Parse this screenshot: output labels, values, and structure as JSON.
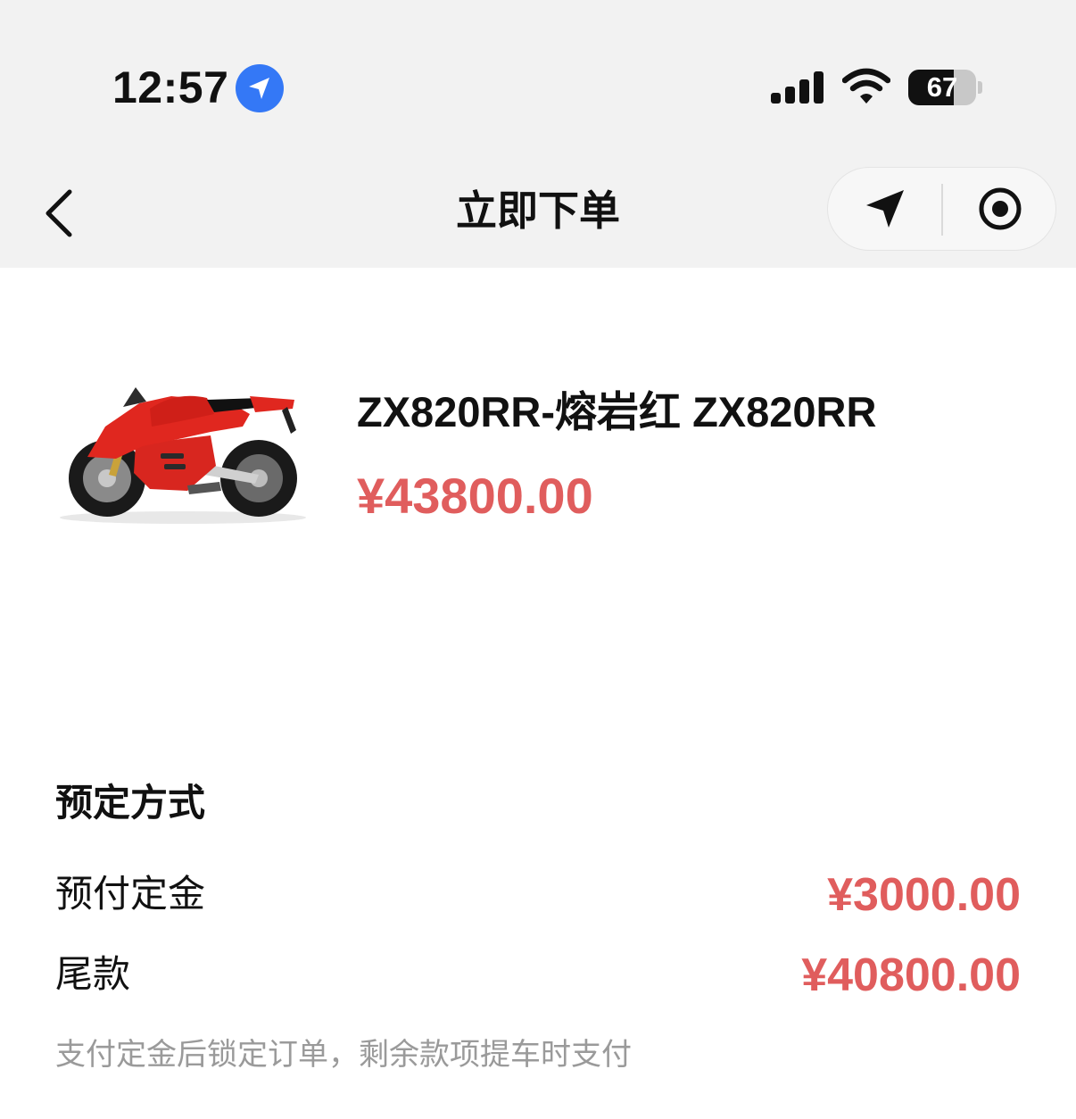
{
  "status_bar": {
    "time": "12:57",
    "battery_level": "67",
    "battery_fraction": 0.67,
    "icons": [
      "location-arrow-icon",
      "signal-bars-icon",
      "wifi-icon",
      "battery-icon"
    ]
  },
  "nav": {
    "title": "立即下单",
    "back_icon": "chevron-left-icon",
    "capsule_icons": [
      "share-arrow-icon",
      "target-circle-icon"
    ]
  },
  "product": {
    "name": "ZX820RR-熔岩红 ZX820RR",
    "price": "¥43800.00",
    "image": "red-sport-motorcycle"
  },
  "booking": {
    "section_title": "预定方式",
    "rows": [
      {
        "label": "预付定金",
        "value": "¥3000.00"
      },
      {
        "label": "尾款",
        "value": "¥40800.00"
      }
    ],
    "note": "支付定金后锁定订单，剩余款项提车时支付"
  },
  "colors": {
    "accent_red": "#e05d5d",
    "header_bg": "#f2f2f2",
    "location_blue": "#3478f6",
    "text": "#111111",
    "muted": "#9a9a9a"
  }
}
